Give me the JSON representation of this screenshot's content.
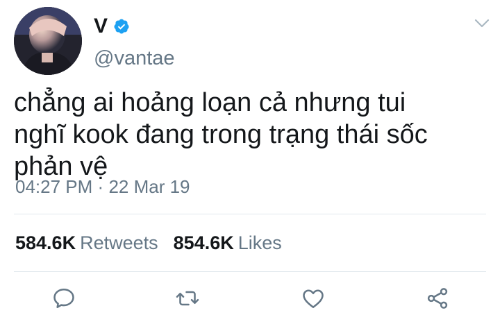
{
  "tweet": {
    "display_name": "V",
    "handle": "@vantae",
    "verified": true,
    "text": "chẳng ai hoảng loạn cả nhưng tui\nnghĩ kook đang trong trạng thái sốc\nphản vệ",
    "time": "04:27 PM",
    "separator": "·",
    "date": "22 Mar 19"
  },
  "stats": {
    "retweets_count": "584.6K",
    "retweets_label": "Retweets",
    "likes_count": "854.6K",
    "likes_label": "Likes"
  },
  "icons": {
    "reply": "reply-icon",
    "retweet": "retweet-icon",
    "like": "heart-icon",
    "share": "share-icon",
    "more": "chevron-down-icon",
    "verified": "verified-badge-icon"
  },
  "colors": {
    "accent": "#1da1f2",
    "text": "#14171a",
    "secondary": "#657786",
    "divider": "#e1e8ed"
  }
}
